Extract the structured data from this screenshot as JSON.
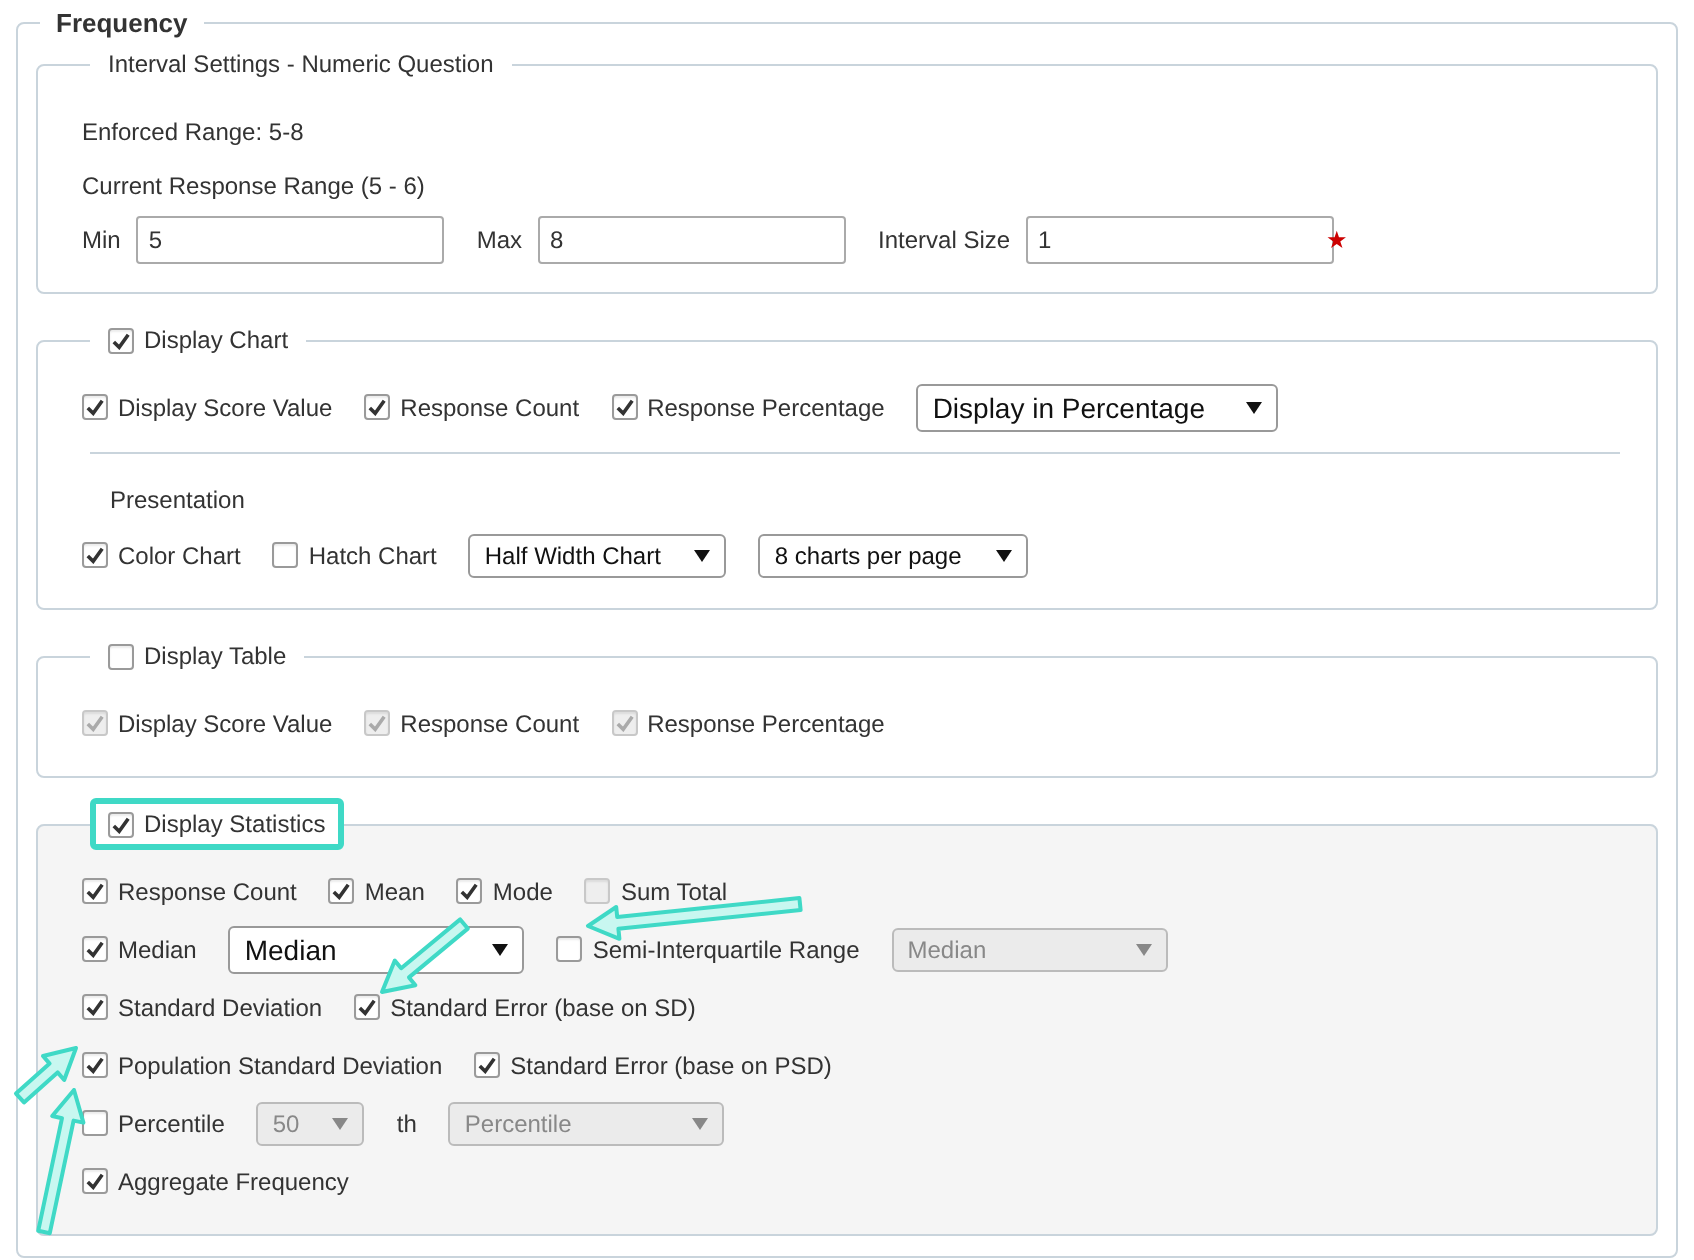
{
  "frequency": {
    "title": "Frequency",
    "sections": [
      {
        "title": "Interval Settings - Numeric Question",
        "rows": [
          {
            "kind": "text",
            "text": "Enforced Range: 5-8"
          },
          {
            "kind": "text",
            "text": "Current Response Range (5 - 6)"
          },
          {
            "kind": "items",
            "items": [
              {
                "kind": "field",
                "label": "Min",
                "value": "5"
              },
              {
                "kind": "field",
                "label": "Max",
                "value": "8"
              },
              {
                "kind": "field",
                "label": "Interval Size",
                "value": "1",
                "marker": "★"
              }
            ]
          }
        ]
      },
      {
        "title": "Display Chart",
        "checked": true,
        "rows": [
          {
            "kind": "items",
            "items": [
              {
                "kind": "checkbox",
                "label": "Display Score Value",
                "checked": true,
                "disabled": false
              },
              {
                "kind": "checkbox",
                "label": "Response Count",
                "checked": true,
                "disabled": false
              },
              {
                "kind": "checkbox",
                "label": "Response Percentage",
                "checked": true,
                "disabled": false
              },
              {
                "kind": "select-large",
                "value": "Display in Percentage",
                "disabled": false
              }
            ]
          },
          {
            "kind": "divider"
          },
          {
            "kind": "heading",
            "text": "Presentation"
          },
          {
            "kind": "items",
            "items": [
              {
                "kind": "checkbox",
                "label": "Color Chart",
                "checked": true,
                "disabled": false
              },
              {
                "kind": "checkbox",
                "label": "Hatch Chart",
                "checked": false,
                "disabled": false
              },
              {
                "kind": "select",
                "value": "Half Width Chart",
                "disabled": false
              },
              {
                "kind": "select",
                "value": "8 charts per page",
                "disabled": false
              }
            ]
          }
        ]
      },
      {
        "title": "Display Table",
        "checked": false,
        "rows": [
          {
            "kind": "items",
            "items": [
              {
                "kind": "checkbox",
                "label": "Display Score Value",
                "checked": true,
                "disabled": true
              },
              {
                "kind": "checkbox",
                "label": "Response Count",
                "checked": true,
                "disabled": true
              },
              {
                "kind": "checkbox",
                "label": "Response Percentage",
                "checked": true,
                "disabled": true
              }
            ]
          }
        ]
      },
      {
        "title": "Display Statistics",
        "checked": true,
        "highlighted": true,
        "rows": [
          {
            "kind": "items",
            "items": [
              {
                "kind": "checkbox",
                "label": "Response Count",
                "checked": true,
                "disabled": false
              },
              {
                "kind": "checkbox",
                "label": "Mean",
                "checked": true,
                "disabled": false
              },
              {
                "kind": "checkbox",
                "label": "Mode",
                "checked": true,
                "disabled": false
              },
              {
                "kind": "checkbox",
                "label": "Sum Total",
                "checked": false,
                "disabled": true
              }
            ]
          },
          {
            "kind": "items",
            "items": [
              {
                "kind": "checkbox",
                "label": "Median",
                "checked": true,
                "disabled": false
              },
              {
                "kind": "select-large",
                "value": "Median",
                "disabled": false
              },
              {
                "kind": "checkbox",
                "label": "Semi-Interquartile Range",
                "checked": false,
                "disabled": false
              },
              {
                "kind": "select",
                "value": "Median",
                "disabled": true
              }
            ]
          },
          {
            "kind": "items",
            "items": [
              {
                "kind": "checkbox",
                "label": "Standard Deviation",
                "checked": true,
                "disabled": false
              },
              {
                "kind": "checkbox",
                "label": "Standard Error (base on SD)",
                "checked": true,
                "disabled": false
              }
            ]
          },
          {
            "kind": "items",
            "items": [
              {
                "kind": "checkbox",
                "label": "Population Standard Deviation",
                "checked": true,
                "disabled": false
              },
              {
                "kind": "checkbox",
                "label": "Standard Error (base on PSD)",
                "checked": true,
                "disabled": false
              }
            ]
          },
          {
            "kind": "items",
            "items": [
              {
                "kind": "checkbox",
                "label": "Percentile",
                "checked": false,
                "disabled": false
              },
              {
                "kind": "select",
                "value": "50",
                "disabled": true
              },
              {
                "kind": "label",
                "text": "th"
              },
              {
                "kind": "select",
                "value": "Percentile",
                "disabled": true
              }
            ]
          },
          {
            "kind": "items",
            "items": [
              {
                "kind": "checkbox",
                "label": "Aggregate Frequency",
                "checked": true,
                "disabled": false
              }
            ]
          }
        ]
      }
    ]
  }
}
